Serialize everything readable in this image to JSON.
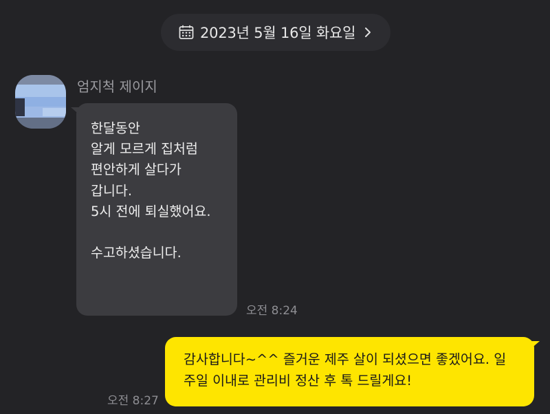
{
  "date_bar": {
    "label": "2023년 5월 16일 화요일",
    "icon": "calendar-icon",
    "chevron_icon": "chevron-right-icon"
  },
  "incoming": {
    "sender": "엄지척 제이지",
    "avatar": "blurred-profile-image",
    "lines": [
      "한달동안",
      "알게 모르게 집처럼",
      "편안하게 살다가",
      "갑니다.",
      "5시 전에 퇴실했어요.",
      "",
      "수고하셨습니다."
    ],
    "time": "오전 8:24"
  },
  "outgoing": {
    "lines": [
      "감사합니다~^^ 즐거운 제주 살이 되셨으면 좋겠어요. 일",
      "주일 이내로 관리비 정산 후 톡 드릴게요!"
    ],
    "time": "오전 8:27"
  },
  "colors": {
    "background": "#232326",
    "incoming_bubble": "#3c3c40",
    "outgoing_bubble": "#fee500",
    "date_pill": "#2c2c30"
  }
}
